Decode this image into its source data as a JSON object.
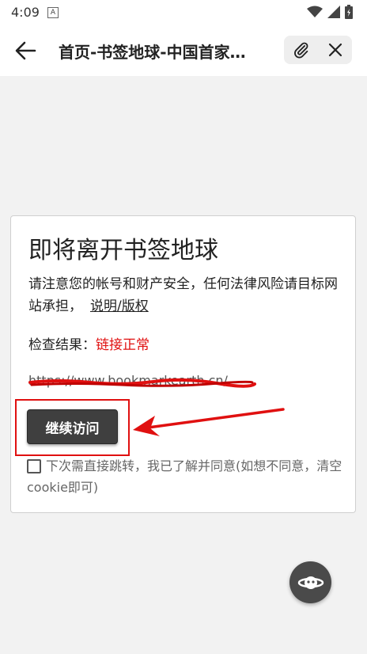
{
  "status_bar": {
    "time": "4:09",
    "a_icon_label": "A",
    "icons": [
      "wifi-icon",
      "signal-icon",
      "battery-icon"
    ]
  },
  "app_bar": {
    "title": "首页-书签地球-中国首家…",
    "icons": [
      "back-arrow-icon",
      "paperclip-icon",
      "close-icon"
    ]
  },
  "dialog": {
    "title": "即将离开书签地球",
    "notice_text": "请注意您的帐号和财产安全，任何法律风险请目标网站承担，",
    "notice_link": "说明/版权",
    "check_label": "检查结果：",
    "check_result": "链接正常",
    "target_url": "https://www.bookmarkearth.cn/",
    "continue_label": "继续访问",
    "consent_text": "下次需直接跳转，我已了解并同意(如想不同意，清空cookie即可)",
    "consent_checked": false
  },
  "colors": {
    "accent_red": "#e01010",
    "button_dark": "#3f3f3f",
    "background": "#f2f2f2"
  },
  "fab": {
    "icon": "planet-icon"
  }
}
